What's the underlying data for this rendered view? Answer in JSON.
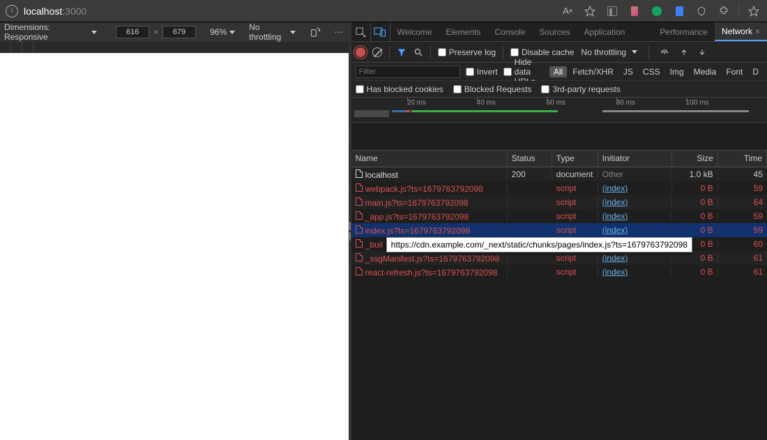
{
  "address": {
    "host": "localhost",
    "port": ":3000"
  },
  "toolbar_labels": {
    "aa": "A",
    "aa_sup": "א"
  },
  "device": {
    "dimensions_label": "Dimensions: Responsive",
    "width": "616",
    "height": "679",
    "zoom": "96%",
    "throttling": "No throttling"
  },
  "tabs": [
    "Welcome",
    "Elements",
    "Console",
    "Sources",
    "Application",
    "Performance",
    "Network"
  ],
  "active_tab": "Network",
  "net_toolbar": {
    "preserve": "Preserve log",
    "disable_cache": "Disable cache",
    "throttling": "No throttling"
  },
  "filters": {
    "placeholder": "Filter",
    "invert": "Invert",
    "hide_data_urls": "Hide data URLs",
    "types": [
      "All",
      "Fetch/XHR",
      "JS",
      "CSS",
      "Img",
      "Media",
      "Font",
      "D"
    ],
    "active_type": "All",
    "row2": [
      "Has blocked cookies",
      "Blocked Requests",
      "3rd-party requests"
    ]
  },
  "timeline_ticks": [
    "20 ms",
    "40 ms",
    "60 ms",
    "80 ms",
    "100 ms"
  ],
  "columns": [
    "Name",
    "Status",
    "Type",
    "Initiator",
    "Size",
    "Time"
  ],
  "rows": [
    {
      "name": "localhost",
      "status": "200",
      "type": "document",
      "initiator": "Other",
      "init_style": "grey",
      "size": "1.0 kB",
      "time": "45",
      "err": false
    },
    {
      "name": "webpack.js?ts=1679763792098",
      "status": "",
      "type": "script",
      "initiator": "(index)",
      "init_style": "link",
      "size": "0 B",
      "time": "59",
      "err": true
    },
    {
      "name": "main.js?ts=1679763792098",
      "status": "",
      "type": "script",
      "initiator": "(index)",
      "init_style": "link",
      "size": "0 B",
      "time": "64",
      "err": true
    },
    {
      "name": "_app.js?ts=1679763792098",
      "status": "",
      "type": "script",
      "initiator": "(index)",
      "init_style": "link",
      "size": "0 B",
      "time": "59",
      "err": true
    },
    {
      "name": "index.js?ts=1679763792098",
      "status": "",
      "type": "script",
      "initiator": "(index)",
      "init_style": "link",
      "size": "0 B",
      "time": "59",
      "err": true,
      "selected": true
    },
    {
      "name": "_buil",
      "status": "",
      "type": "",
      "initiator": "",
      "init_style": "link",
      "size": "0 B",
      "time": "60",
      "err": true
    },
    {
      "name": "_ssgManifest.js?ts=1679763792098",
      "status": "",
      "type": "script",
      "initiator": "(index)",
      "init_style": "link",
      "size": "0 B",
      "time": "61",
      "err": true
    },
    {
      "name": "react-refresh.js?ts=1679763792098",
      "status": "",
      "type": "script",
      "initiator": "(index)",
      "init_style": "link",
      "size": "0 B",
      "time": "61",
      "err": true
    }
  ],
  "tooltip": "https://cdn.example.com/_next/static/chunks/pages/index.js?ts=1679763792098"
}
